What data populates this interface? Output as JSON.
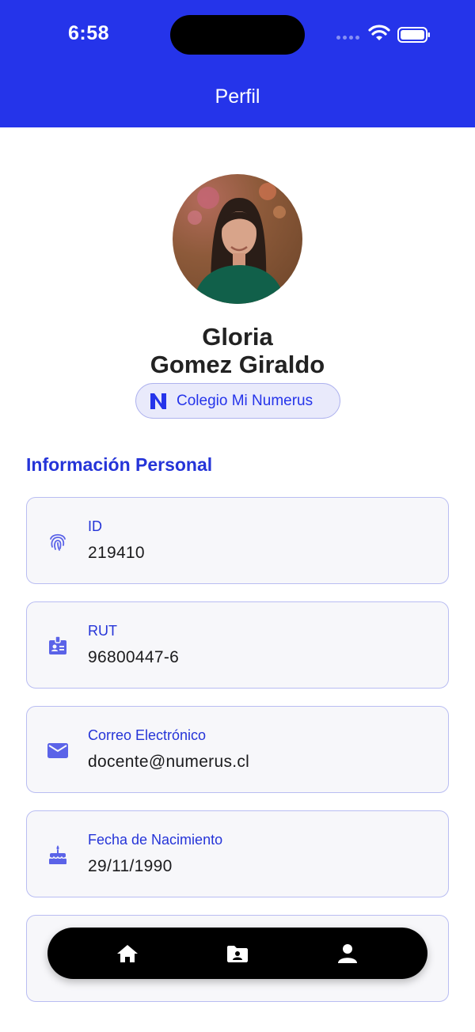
{
  "status_bar": {
    "time": "6:58"
  },
  "header": {
    "title": "Perfil"
  },
  "profile": {
    "first_name": "Gloria",
    "last_name": "Gomez Giraldo",
    "school": "Colegio Mi Numerus"
  },
  "section": {
    "title": "Información Personal"
  },
  "fields": [
    {
      "label": "ID",
      "value": "219410",
      "icon": "fingerprint-icon"
    },
    {
      "label": "RUT",
      "value": "96800447-6",
      "icon": "id-badge-icon"
    },
    {
      "label": "Correo Electrónico",
      "value": "docente@numerus.cl",
      "icon": "mail-icon"
    },
    {
      "label": "Fecha de Nacimiento",
      "value": "29/11/1990",
      "icon": "cake-icon"
    }
  ],
  "tab_bar": {
    "items": [
      {
        "icon": "home-icon"
      },
      {
        "icon": "folder-user-icon"
      },
      {
        "icon": "person-icon"
      }
    ]
  },
  "colors": {
    "brand": "#2534ea",
    "accent_text": "#2534d8",
    "card_border": "#b9bdf2",
    "tab_bar": "#000000"
  }
}
